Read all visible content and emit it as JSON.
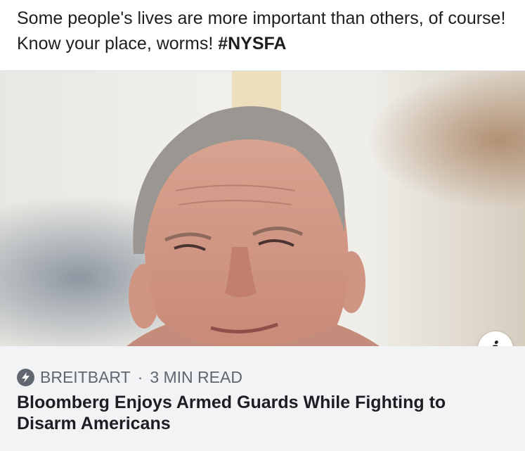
{
  "post": {
    "caption_text": "Some people's lives are more important than others, of course! Know your place, worms! ",
    "caption_hashtag": "#NYSFA"
  },
  "link_card": {
    "source": "BREITBART",
    "separator": "·",
    "read_time": "3 MIN READ",
    "headline": "Bloomberg Enjoys Armed Guards While Fighting to Disarm Americans",
    "info_icon": "info-icon",
    "source_icon": "lightning-bolt-icon"
  },
  "colors": {
    "text_primary": "#1c1e21",
    "text_secondary": "#606770",
    "card_background": "#f2f3f5",
    "divider": "#dadde1"
  }
}
